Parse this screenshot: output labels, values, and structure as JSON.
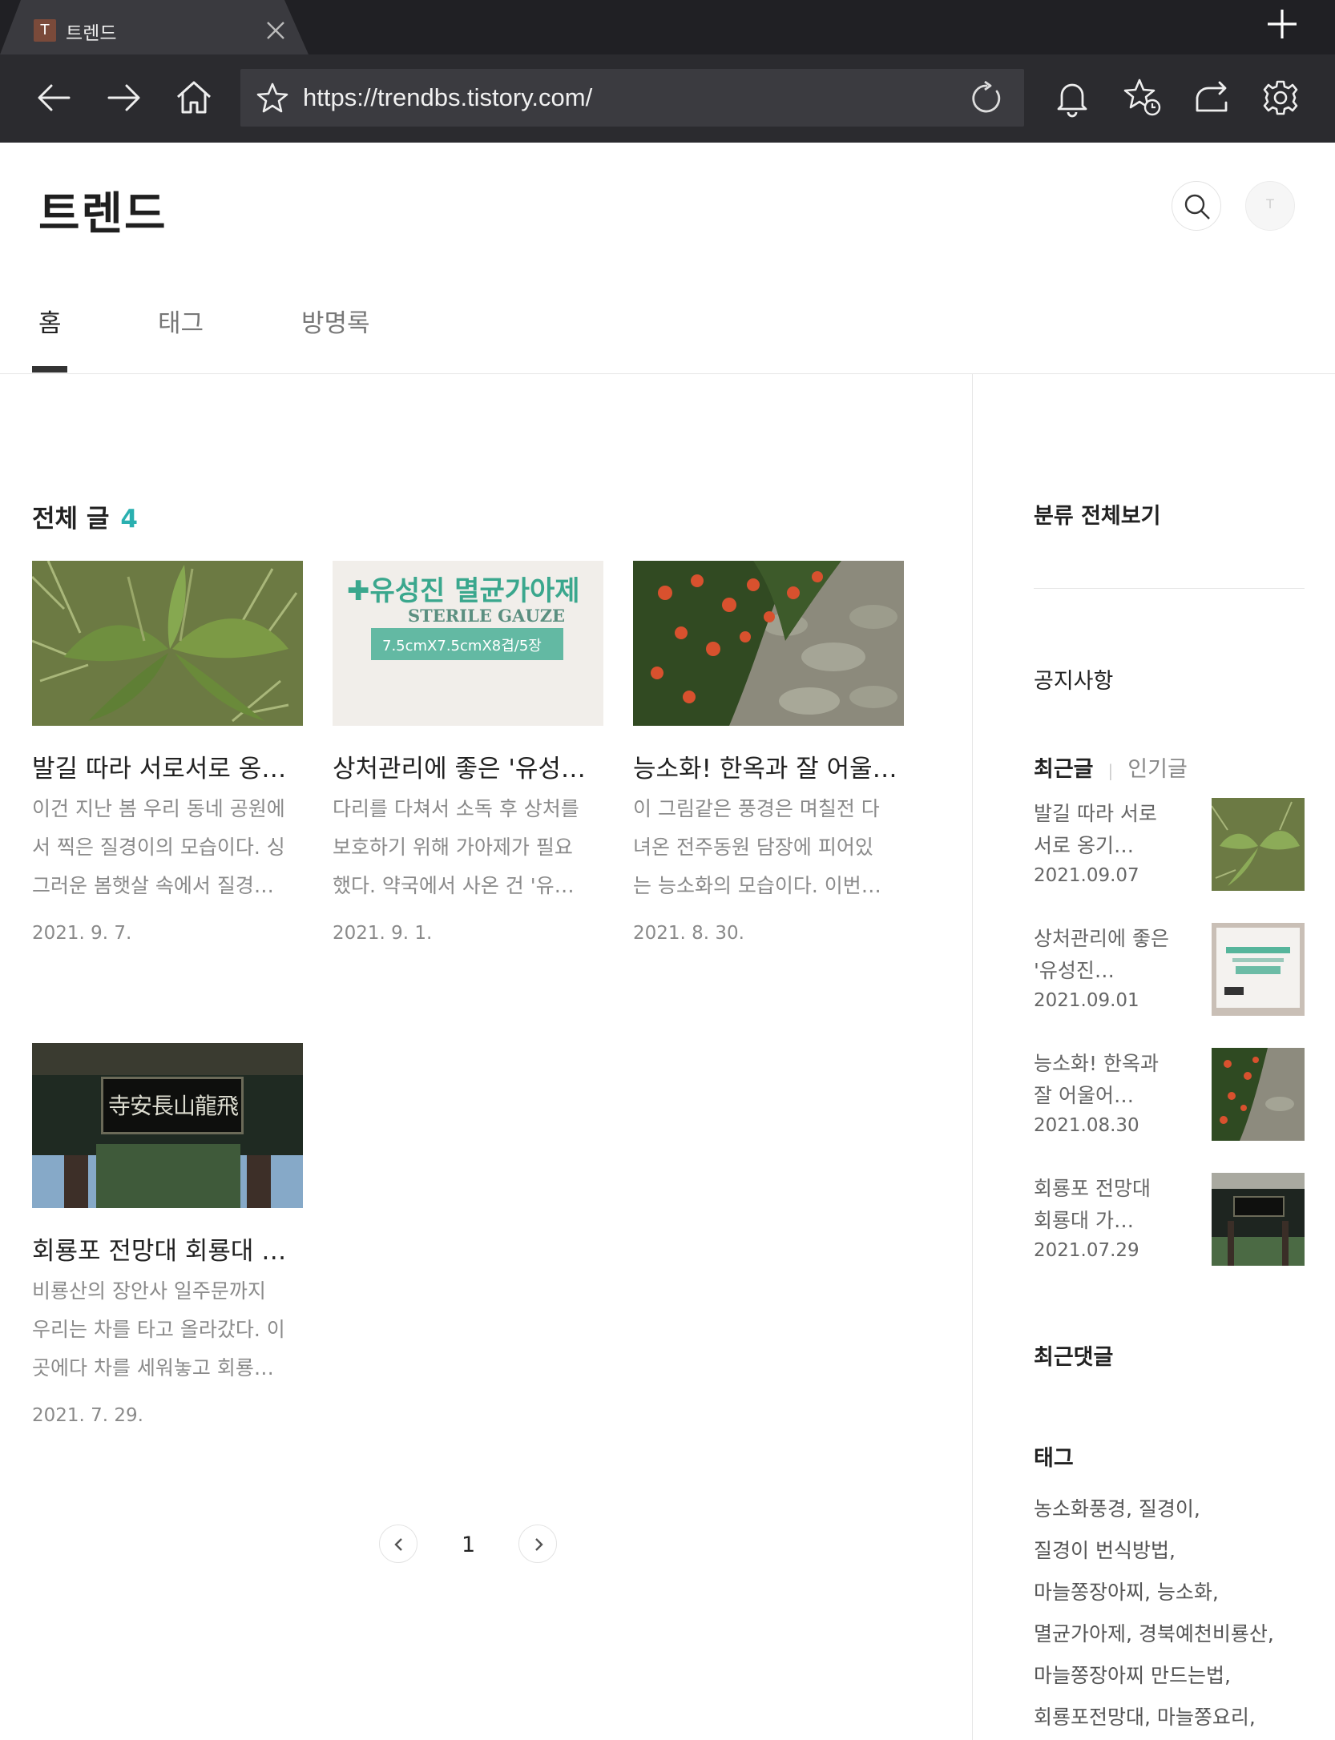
{
  "browser": {
    "tab_title": "트렌드",
    "favicon_letter": "T",
    "url": "https://trendbs.tistory.com/"
  },
  "blog": {
    "title": "트렌드",
    "menu": [
      "홈",
      "태그",
      "방명록"
    ]
  },
  "posts_section": {
    "title": "전체 글",
    "count": "4"
  },
  "posts": [
    {
      "title": "발길 따라 서로서로 옹기종기 모여 사는 질경이",
      "summary": [
        "이건 지난 봄 우리 동네 공원에",
        "서 찍은 질경이의 모습이다. 싱",
        "그러운 봄햇살 속에서 질경…"
      ],
      "date": "2021. 9. 7."
    },
    {
      "title": "상처관리에 좋은 '유성진 멸균가아제'",
      "summary": [
        "다리를 다쳐서 소독 후 상처를",
        "보호하기 위해 가아제가 필요",
        "했다. 약국에서 사온 건 '유…"
      ],
      "date": "2021. 9. 1."
    },
    {
      "title": "능소화! 한옥과 잘 어울어진 풍경",
      "summary": [
        "이 그림같은 풍경은 며칠전 다",
        "녀온 전주동원 담장에 피어있",
        "는 능소화의 모습이다. 이번…"
      ],
      "date": "2021. 8. 30."
    },
    {
      "title": "회룡포 전망대 회룡대 가는길",
      "summary": [
        "비룡산의 장안사 일주문까지",
        "우리는 차를 타고 올라갔다. 이",
        "곳에다 차를 세워놓고 회룡…"
      ],
      "date": "2021. 7. 29."
    }
  ],
  "thumb_text": {
    "gauze_title": "✚유성진 멸균가아제",
    "gauze_sub": "STERILE GAUZE",
    "gauze_size": "7.5cmX7.5cmX8겹/5장",
    "temple_sign": "寺安長山龍飛"
  },
  "pagination": {
    "current": "1"
  },
  "sidebar": {
    "category_title": "분류 전체보기",
    "notice_title": "공지사항",
    "recent_tab": "최근글",
    "popular_tab": "인기글",
    "recent_posts": [
      {
        "title": "발길 따라 서로서로 옹기…",
        "date": "2021.09.07"
      },
      {
        "title": "상처관리에 좋은 '유성진…",
        "date": "2021.09.01"
      },
      {
        "title": "능소화! 한옥과 잘 어울어…",
        "date": "2021.08.30"
      },
      {
        "title": "회룡포 전망대 회룡대 가…",
        "date": "2021.07.29"
      }
    ],
    "comments_title": "최근댓글",
    "tags_title": "태그",
    "tag_lines": [
      "농소화풍경,  질경이,",
      "질경이 번식방법,",
      "마늘쫑장아찌,  능소화,",
      "멸균가아제,  경북예천비룡산,",
      "마늘쫑장아찌 만드는법,",
      "회룡포전망대,  마늘쫑요리,"
    ]
  },
  "colors": {
    "accent": "#2ab0b0",
    "chrome_bg": "#2b2b2f",
    "tabstrip_bg": "#202024"
  }
}
